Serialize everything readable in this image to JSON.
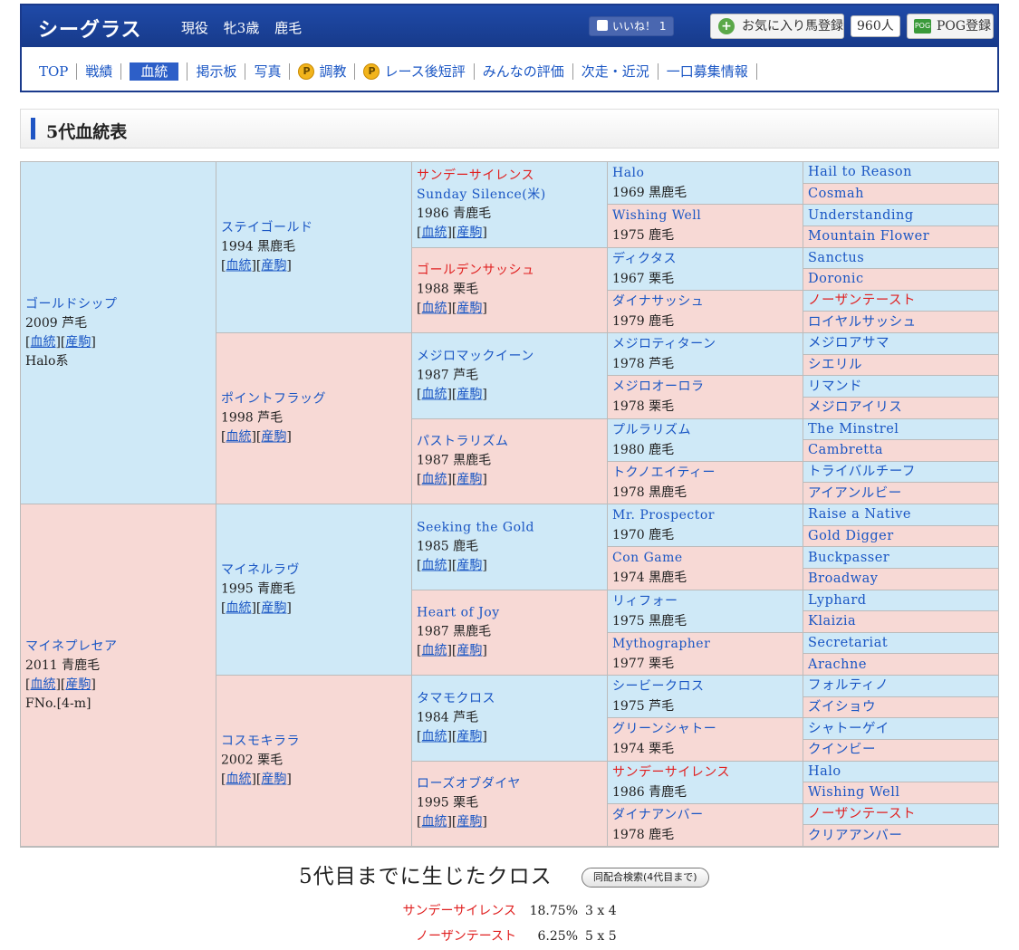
{
  "header": {
    "horse_name": "シーグラス",
    "status": "現役",
    "sex_age": "牝3歳",
    "coat": "鹿毛",
    "like_label": "いいね！",
    "like_count": "1",
    "fav_label": "お気に入り馬登録",
    "fav_count": "960人",
    "pog_label": "POG登録",
    "pog_icon": "POG"
  },
  "nav": [
    "TOP",
    "戦績",
    "血統",
    "掲示板",
    "写真",
    "調教",
    "レース後短評",
    "みんなの評価",
    "次走・近況",
    "一口募集情報"
  ],
  "section_title": "5代血統表",
  "link_labels": {
    "pedigree": "血統",
    "offspring": "産駒"
  },
  "pedigree": {
    "gen1": [
      {
        "name": "ゴールドシップ",
        "info": "2009 芦毛",
        "extra": "Halo系"
      },
      {
        "name": "マイネプレセア",
        "info": "2011 青鹿毛",
        "extra": "FNo.[4-m]"
      }
    ],
    "gen2": [
      {
        "name": "ステイゴールド",
        "info": "1994 黒鹿毛"
      },
      {
        "name": "ポイントフラッグ",
        "info": "1998 芦毛"
      },
      {
        "name": "マイネルラヴ",
        "info": "1995 青鹿毛"
      },
      {
        "name": "コスモキララ",
        "info": "2002 栗毛"
      }
    ],
    "gen3": [
      {
        "name": "サンデーサイレンス",
        "name2": "Sunday Silence(米)",
        "info": "1986 青鹿毛",
        "red": true
      },
      {
        "name": "ゴールデンサッシュ",
        "info": "1988 栗毛",
        "red": true
      },
      {
        "name": "メジロマックイーン",
        "info": "1987 芦毛"
      },
      {
        "name": "パストラリズム",
        "info": "1987 黒鹿毛"
      },
      {
        "name": "Seeking the Gold",
        "info": "1985 鹿毛"
      },
      {
        "name": "Heart of Joy",
        "info": "1987 黒鹿毛"
      },
      {
        "name": "タマモクロス",
        "info": "1984 芦毛"
      },
      {
        "name": "ローズオブダイヤ",
        "info": "1995 栗毛"
      }
    ],
    "gen4": [
      {
        "name": "Halo",
        "info": "1969 黒鹿毛"
      },
      {
        "name": "Wishing Well",
        "info": "1975 鹿毛"
      },
      {
        "name": "ディクタス",
        "info": "1967 栗毛"
      },
      {
        "name": "ダイナサッシュ",
        "info": "1979 鹿毛"
      },
      {
        "name": "メジロティターン",
        "info": "1978 芦毛"
      },
      {
        "name": "メジロオーロラ",
        "info": "1978 栗毛"
      },
      {
        "name": "プルラリズム",
        "info": "1980 鹿毛"
      },
      {
        "name": "トクノエイティー",
        "info": "1978 黒鹿毛"
      },
      {
        "name": "Mr. Prospector",
        "info": "1970 鹿毛"
      },
      {
        "name": "Con Game",
        "info": "1974 黒鹿毛"
      },
      {
        "name": "リィフォー",
        "info": "1975 黒鹿毛"
      },
      {
        "name": "Mythographer",
        "info": "1977 栗毛"
      },
      {
        "name": "シービークロス",
        "info": "1975 芦毛"
      },
      {
        "name": "グリーンシャトー",
        "info": "1974 栗毛"
      },
      {
        "name": "サンデーサイレンス",
        "info": "1986 青鹿毛",
        "red": true
      },
      {
        "name": "ダイナアンバー",
        "info": "1978 鹿毛"
      }
    ],
    "gen5": [
      {
        "name": "Hail to Reason"
      },
      {
        "name": "Cosmah"
      },
      {
        "name": "Understanding"
      },
      {
        "name": "Mountain Flower"
      },
      {
        "name": "Sanctus"
      },
      {
        "name": "Doronic"
      },
      {
        "name": "ノーザンテースト",
        "red": true
      },
      {
        "name": "ロイヤルサッシュ"
      },
      {
        "name": "メジロアサマ"
      },
      {
        "name": "シエリル"
      },
      {
        "name": "リマンド"
      },
      {
        "name": "メジロアイリス"
      },
      {
        "name": "The Minstrel"
      },
      {
        "name": "Cambretta"
      },
      {
        "name": "トライバルチーフ"
      },
      {
        "name": "アイアンルビー"
      },
      {
        "name": "Raise a Native"
      },
      {
        "name": "Gold Digger"
      },
      {
        "name": "Buckpasser"
      },
      {
        "name": "Broadway"
      },
      {
        "name": "Lyphard"
      },
      {
        "name": "Klaizia"
      },
      {
        "name": "Secretariat"
      },
      {
        "name": "Arachne"
      },
      {
        "name": "フォルティノ"
      },
      {
        "name": "ズイショウ"
      },
      {
        "name": "シャトーゲイ"
      },
      {
        "name": "クインビー"
      },
      {
        "name": "Halo"
      },
      {
        "name": "Wishing Well"
      },
      {
        "name": "ノーザンテースト",
        "red": true
      },
      {
        "name": "クリアアンバー"
      }
    ]
  },
  "cross": {
    "title": "5代目までに生じたクロス",
    "search_button": "同配合検索(4代目まで)",
    "rows": [
      {
        "name": "サンデーサイレンス",
        "pct": "18.75%",
        "gen": "3 x 4"
      },
      {
        "name": "ノーザンテースト",
        "pct": "6.25%",
        "gen": "5 x 5"
      }
    ]
  }
}
